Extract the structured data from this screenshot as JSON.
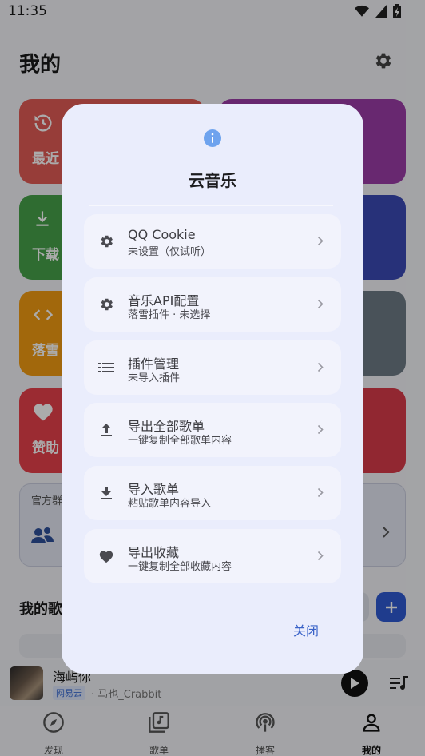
{
  "status_bar": {
    "time": "11:35"
  },
  "page": {
    "title": "我的"
  },
  "cards": {
    "recent": "最近",
    "download": "下载",
    "plugin": "落雪",
    "sponsor": "赞助"
  },
  "group": {
    "label": "官方群"
  },
  "playlists": {
    "header": "我的歌"
  },
  "player": {
    "title": "海屿你",
    "source": "网易云",
    "artist": "· 马也_Crabbit"
  },
  "bottom_nav": [
    {
      "label": "发现",
      "icon": "compass-icon"
    },
    {
      "label": "歌单",
      "icon": "music-library-icon"
    },
    {
      "label": "播客",
      "icon": "podcast-icon"
    },
    {
      "label": "我的",
      "icon": "person-icon"
    }
  ],
  "dialog": {
    "title": "云音乐",
    "close_label": "关闭",
    "options": [
      {
        "title": "QQ Cookie",
        "subtitle": "未设置（仅试听）",
        "icon": "gear-icon"
      },
      {
        "title": "音乐API配置",
        "subtitle": "落雪插件 · 未选择",
        "icon": "gear-icon"
      },
      {
        "title": "插件管理",
        "subtitle": "未导入插件",
        "icon": "list-icon"
      },
      {
        "title": "导出全部歌单",
        "subtitle": "一键复制全部歌单内容",
        "icon": "upload-icon"
      },
      {
        "title": "导入歌单",
        "subtitle": "粘贴歌单内容导入",
        "icon": "download-icon"
      },
      {
        "title": "导出收藏",
        "subtitle": "一键复制全部收藏内容",
        "icon": "heart-icon"
      }
    ]
  },
  "colors": {
    "dialog_bg": "#eaedfc",
    "accent_blue": "#3a63c8",
    "info_icon": "#6ea3ee"
  }
}
